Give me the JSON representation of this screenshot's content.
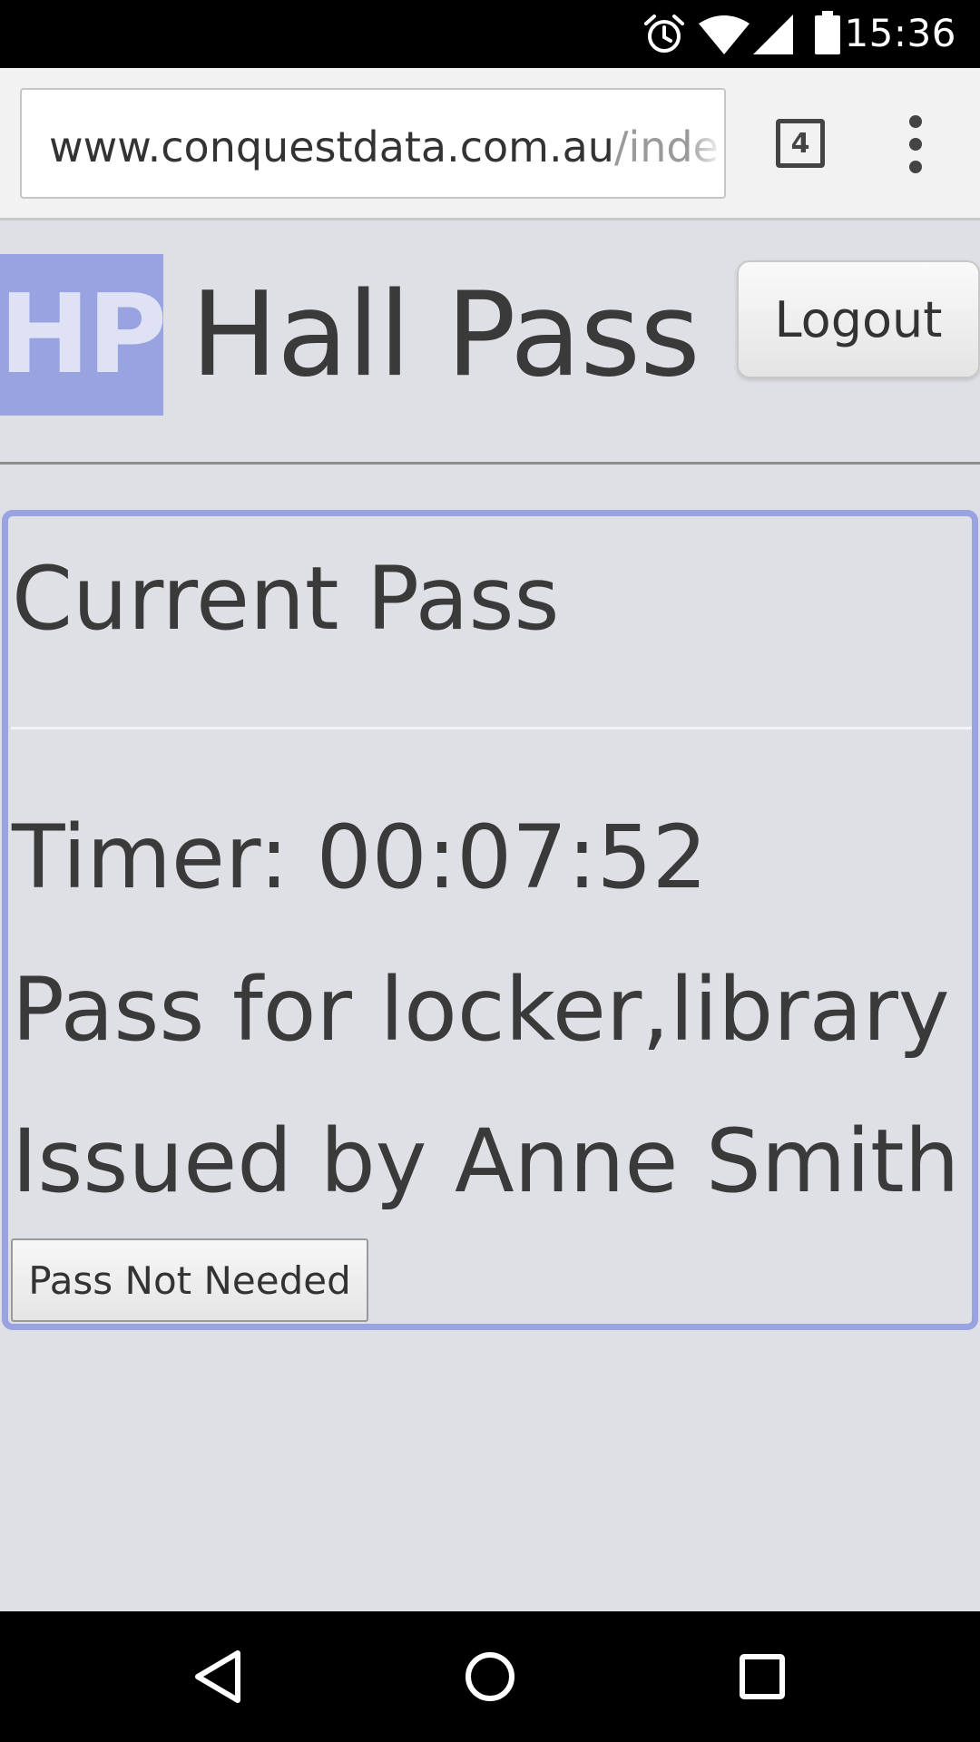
{
  "status_bar": {
    "time": "15:36",
    "icons": [
      "alarm-icon",
      "wifi-icon",
      "signal-icon",
      "battery-icon"
    ]
  },
  "browser": {
    "url_domain": "www.conquestdata.com.au",
    "url_path": "/inde",
    "tab_count": "4"
  },
  "header": {
    "logo_text": "HP",
    "title": "Hall Pass",
    "logout_label": "Logout"
  },
  "pass": {
    "title": "Current Pass",
    "timer_label": "Timer:",
    "timer_value": "00:07:52",
    "destination": "Pass for locker,library",
    "issued_by": "Issued by Anne Smith",
    "not_needed_label": "Pass Not Needed"
  },
  "nav": [
    "back-icon",
    "home-icon",
    "recents-icon"
  ],
  "colors": {
    "accent": "#98a3e0",
    "background": "#dfe0e5",
    "text": "#3a3a3a"
  }
}
